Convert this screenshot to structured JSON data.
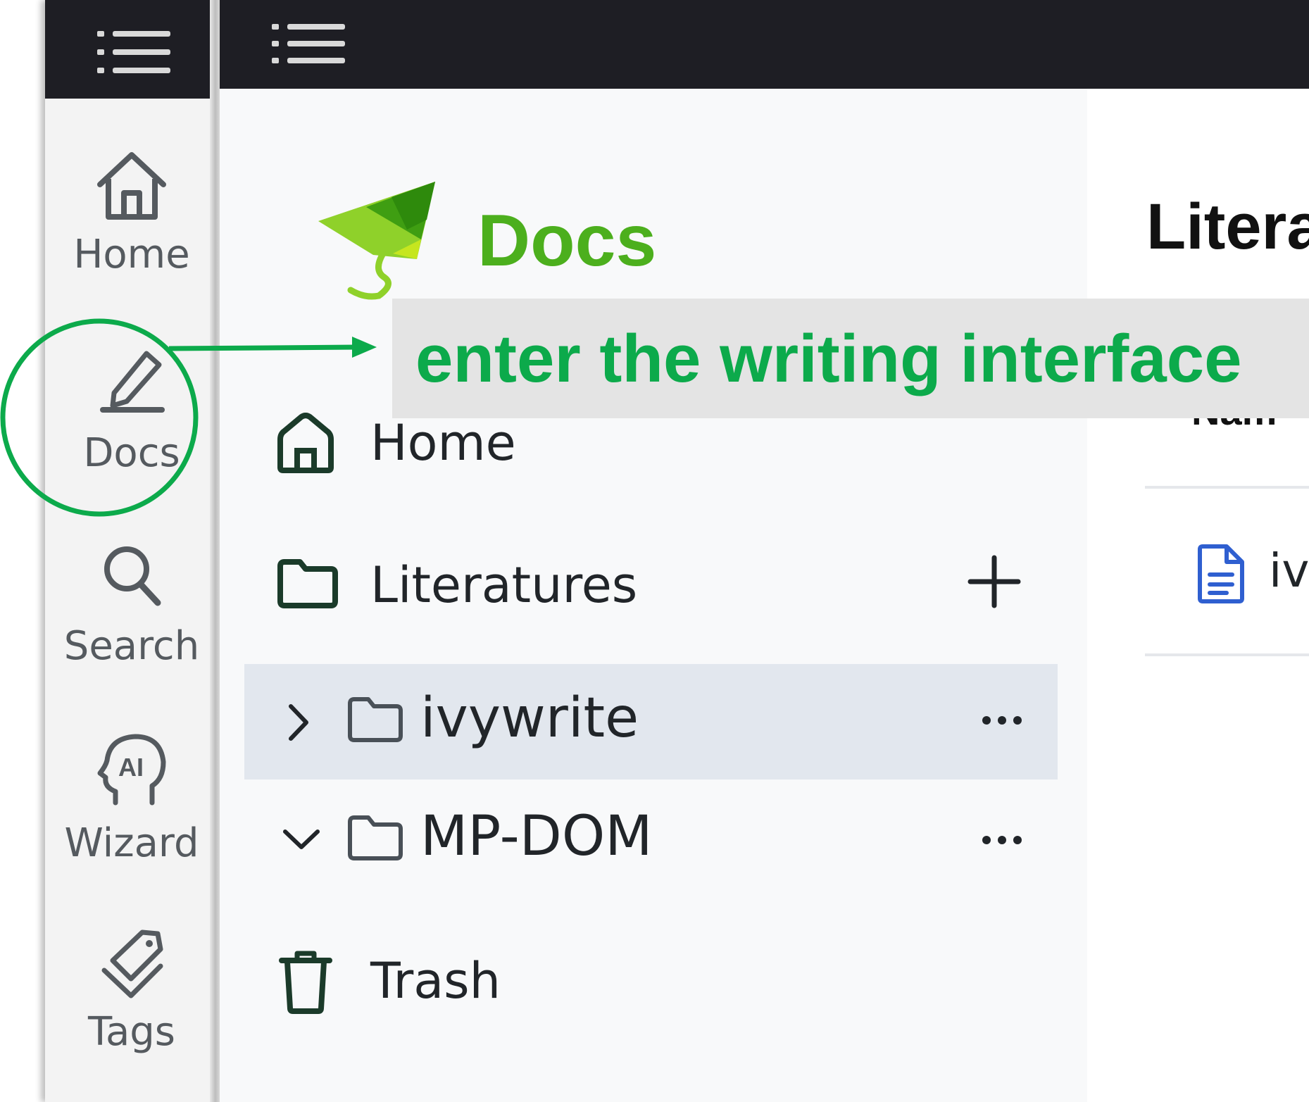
{
  "rail": {
    "items": [
      {
        "label": "Home",
        "icon": "home-icon"
      },
      {
        "label": "Docs",
        "icon": "pencil-icon"
      },
      {
        "label": "Search",
        "icon": "search-icon"
      },
      {
        "label": "Wizard",
        "icon": "ai-head-icon"
      },
      {
        "label": "Tags",
        "icon": "tags-icon"
      }
    ]
  },
  "brand": {
    "name": "Docs",
    "logo": "kite-logo"
  },
  "sidebar": {
    "home_label": "Home",
    "literatures_label": "Literatures",
    "folders": [
      {
        "name": "ivywrite",
        "expanded": false,
        "selected": true
      },
      {
        "name": "MP-DOM",
        "expanded": true,
        "selected": false
      }
    ],
    "trash_label": "Trash"
  },
  "content": {
    "title": "Litera",
    "header_partial": "Nam",
    "row_partial": "iv"
  },
  "annotation": {
    "text": "enter the writing interface",
    "color": "#0caa4b"
  },
  "colors": {
    "topbar": "#1e1e24",
    "brand_green": "#4caf1d",
    "selected_row": "#e2e7ee",
    "doc_icon": "#2f5fd0"
  }
}
